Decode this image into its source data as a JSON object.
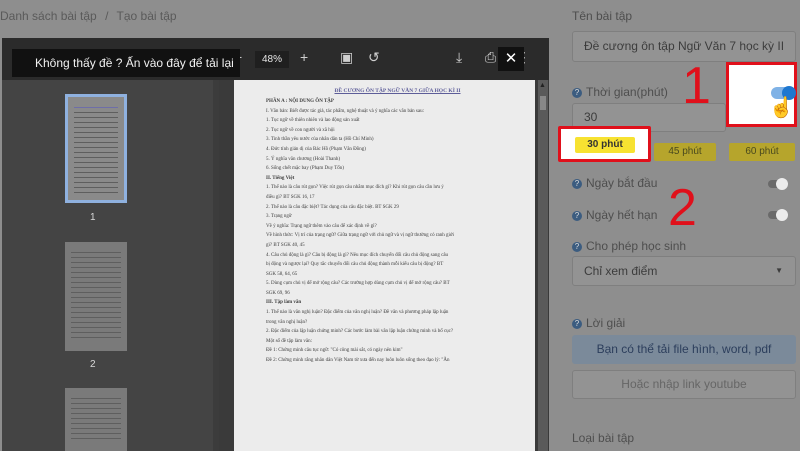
{
  "breadcrumb": {
    "parent": "Danh sách bài tập",
    "separator": "/",
    "current": "Tạo bài tập"
  },
  "viewer": {
    "zoom": "48%",
    "notice": "Không thấy đề ? Ấn vào đây để tải lại",
    "close": "✕",
    "thumbnails": [
      {
        "num": "1"
      },
      {
        "num": "2"
      }
    ],
    "doc": {
      "title": "ĐỀ CƯƠNG ÔN TẬP NGỮ VĂN 7 GIỮA HỌC KÌ II",
      "lines": [
        {
          "text": "PHẦN A : NỘI DUNG ÔN TẬP",
          "bold": true
        },
        {
          "text": "I. Văn bản: Biết được tác giả, tác phẩm, nghệ thuật và ý nghĩa các văn bản sau:",
          "bold": false
        },
        {
          "text": "1. Tục ngữ về thiên nhiên và lao động sản xuất",
          "bold": false
        },
        {
          "text": "2. Tục ngữ về con người và xã hội",
          "bold": false
        },
        {
          "text": "3. Tinh thần yêu nước của nhân dân ta (Hồ Chí Minh)",
          "bold": false
        },
        {
          "text": "4. Đức tính giản dị của Bác Hồ (Phạm Văn Đồng)",
          "bold": false
        },
        {
          "text": "5. Ý nghĩa văn chương (Hoài Thanh)",
          "bold": false
        },
        {
          "text": "6. Sống chết mặc bay (Phạm Duy Tốn)",
          "bold": false
        },
        {
          "text": "II. Tiếng Việt",
          "bold": true
        },
        {
          "text": "1. Thế nào là câu rút gọn? Việc rút gọn câu nhằm mục đích gì? Khi rút gọn câu cần lưu ý",
          "bold": false
        },
        {
          "text": "điều gì? BT SGK 16, 17",
          "bold": false
        },
        {
          "text": "2. Thế nào là câu đặc biệt? Tác dụng của câu đặc biệt. BT SGK 29",
          "bold": false
        },
        {
          "text": "3. Trạng ngữ",
          "bold": false
        },
        {
          "text": "Về ý nghĩa: Trạng ngữ thêm vào câu để xác định về gì?",
          "bold": false
        },
        {
          "text": "Về hình thức: Vị trí của trạng ngữ? Giữa trạng ngữ với chủ ngữ và vị ngữ thường có ranh giới",
          "bold": false
        },
        {
          "text": "gì? BT SGK 40, 45",
          "bold": false
        },
        {
          "text": "4. Câu chủ động là gì? Câu bị động là gì? Nêu mục đích chuyển đổi câu chủ động sang câu",
          "bold": false
        },
        {
          "text": "bị động và ngược lại? Quy tắc chuyển đổi câu chủ động thành mỗi kiểu câu bị động? BT",
          "bold": false
        },
        {
          "text": "SGK 58, 64, 65",
          "bold": false
        },
        {
          "text": "5. Dùng cụm chủ vị để mở rộng câu? Các trường hợp dùng cụm chủ vị để mở rộng câu? BT",
          "bold": false
        },
        {
          "text": "SGK 69, 96",
          "bold": false
        },
        {
          "text": "III. Tập làm văn",
          "bold": true
        },
        {
          "text": "1. Thế nào là văn nghị luận? Đặc điểm của văn nghị luận? Đề văn và phương pháp lập luận",
          "bold": false
        },
        {
          "text": "trong văn nghị luận?",
          "bold": false
        },
        {
          "text": "2. Đặc điểm của lập luận chứng minh? Các bước làm bài văn lập luận chứng minh và bố cục?",
          "bold": false
        },
        {
          "text": "Một số đề tập làm văn:",
          "bold": false
        },
        {
          "text": "Đề 1: Chứng minh câu tục ngữ: \"Có công mài sắt, có ngày nên kim\"",
          "bold": false
        },
        {
          "text": "Đề 2: Chứng minh rằng nhân dân Việt Nam từ xưa đến nay luôn luôn sống theo đạo lý: \"Ăn",
          "bold": false
        }
      ]
    }
  },
  "panel": {
    "title_label": "Tên bài tập",
    "title_value": "Đề cương ôn tập Ngữ Văn 7 học kỳ II",
    "time_label": "Thời gian(phút)",
    "time_value": "30",
    "chips": [
      "30 phút",
      "45 phút",
      "60 phút"
    ],
    "start_label": "Ngày bắt đầu",
    "end_label": "Ngày hết hạn",
    "allow_label": "Cho phép học sinh",
    "allow_value": "Chỉ xem điểm",
    "solution_label": "Lời giải",
    "upload_text": "Bạn có thể tải file hình, word, pdf",
    "youtube_text": "Hoặc nhập link youtube",
    "type_label": "Loại bài tập"
  },
  "annotations": {
    "step1": "1",
    "step2": "2"
  },
  "colors": {
    "accent": "#1e77d0",
    "highlight_red": "#e0101b",
    "chip_yellow": "#f7e231"
  }
}
